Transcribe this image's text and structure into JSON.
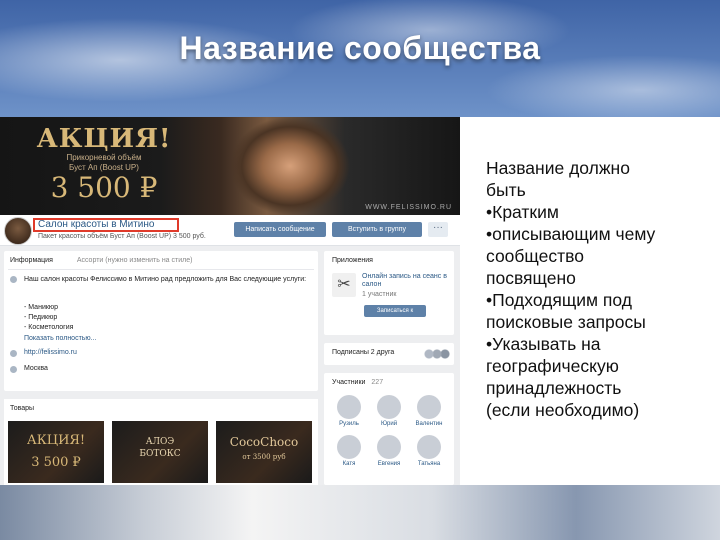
{
  "slide": {
    "title": "Название сообщества"
  },
  "cover": {
    "promo_title": "АКЦИЯ!",
    "promo_sub_1": "Прикорневой объём",
    "promo_sub_2": "Буст Ап (Boost UP)",
    "promo_price": "3 500 ₽",
    "site": "WWW.FELISSIMO.RU"
  },
  "profile": {
    "group_name": "Салон красоты в Митино",
    "status": "Пакет красоты объём Буст Ап (Boost UP) 3 500 руб.",
    "message_btn": "Написать сообщение",
    "join_btn": "Вступить в группу",
    "more_btn": "···"
  },
  "info": {
    "tab_active": "Информация",
    "tab_inactive": "Ассорти (нужно изменить на стиле)",
    "description": "Наш салон красоты Фелиссимо в Митино рад предложить для Вас следующие услуги:",
    "services": [
      "- Маникюр",
      "- Педикюр",
      "- Косметология"
    ],
    "show_more": "Показать полностью...",
    "link": "http://felissimo.ru",
    "address": "Москва"
  },
  "goods": {
    "title": "Товары",
    "items": [
      {
        "line1": "АКЦИЯ!",
        "line2": "3 500 ₽"
      },
      {
        "line1": "АЛОЭ",
        "line2": "БОТОКС"
      },
      {
        "line1": "CocoChoco",
        "line2": "от 3500 руб"
      }
    ]
  },
  "apps": {
    "title": "Приложения",
    "app_name": "Онлайн запись на сеанс в салон",
    "app_sub": "1 участник",
    "app_btn": "Записаться к"
  },
  "subscribers": {
    "label": "Подписаны 2 друга"
  },
  "members": {
    "label": "Участники",
    "count": "227",
    "people": [
      "Рузиль",
      "Юрий",
      "Валентин",
      "Катя",
      "Евгения",
      "Татьяна"
    ]
  },
  "panel": {
    "lines": [
      "Название должно",
      "быть",
      "•Кратким",
      "•описывающим чему",
      "сообщество",
      "посвящено",
      "•Подходящим под",
      "поисковые запросы",
      "•Указывать на",
      "географическую",
      "принадлежность",
      "(если необходимо)"
    ]
  },
  "colors": {
    "vk_button": "#5e81a8",
    "vk_link": "#2a5885",
    "highlight_box": "#e03a2a",
    "promo_gold": "#d8b878"
  }
}
